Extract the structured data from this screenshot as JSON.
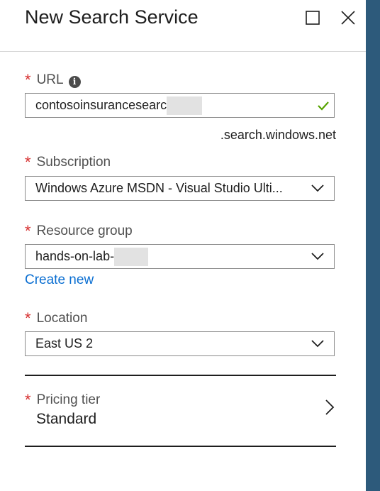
{
  "blade": {
    "title": "New Search Service"
  },
  "fields": {
    "url": {
      "label": "URL",
      "value": "contosoinsurancesearc",
      "suffix": ".search.windows.net"
    },
    "subscription": {
      "label": "Subscription",
      "value": "Windows Azure MSDN - Visual Studio Ulti..."
    },
    "resource_group": {
      "label": "Resource group",
      "value": "hands-on-lab-",
      "create_new_label": "Create new"
    },
    "location": {
      "label": "Location",
      "value": "East US 2"
    },
    "pricing_tier": {
      "label": "Pricing tier",
      "value": "Standard"
    }
  },
  "required_marker": "*",
  "info_glyph": "i",
  "icons": {
    "maximize": "maximize-icon",
    "close": "close-icon",
    "info": "info-icon",
    "valid": "checkmark-icon",
    "dropdown": "chevron-down-icon",
    "navigate": "chevron-right-icon"
  },
  "colors": {
    "required": "#d62d2d",
    "link": "#0a6ed1",
    "valid": "#57a300",
    "accent_strip": "#2d5a7b"
  }
}
